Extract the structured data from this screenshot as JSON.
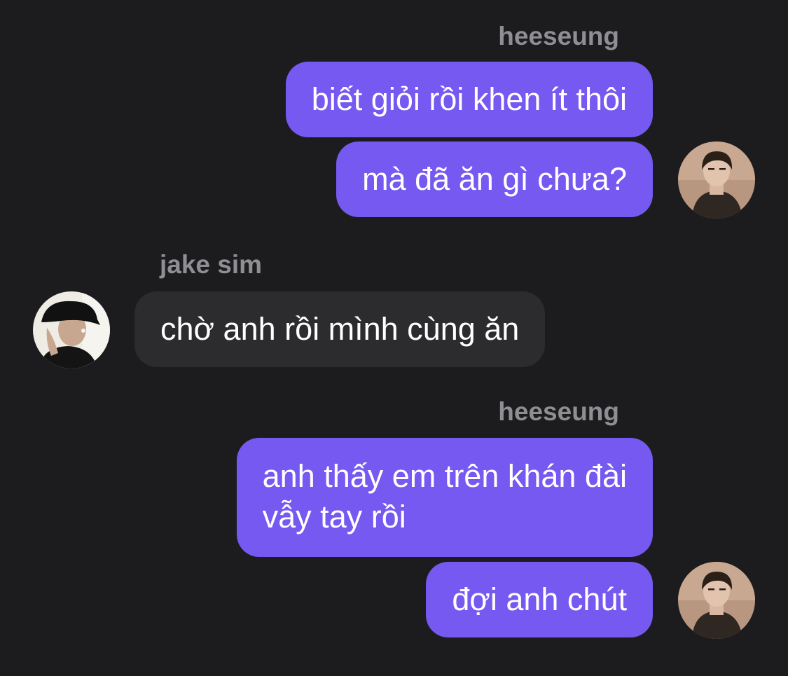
{
  "colors": {
    "background": "#1c1c1e",
    "sender_name": "#8e8e93",
    "outgoing_bubble": "#7559f0",
    "incoming_bubble": "#2c2c2e",
    "message_text": "#ffffff"
  },
  "thread": [
    {
      "sender": "heeseung",
      "side": "right",
      "avatar": "heeseung-avatar",
      "messages": [
        "biết giỏi rồi khen ít thôi",
        "mà đã ăn gì chưa?"
      ]
    },
    {
      "sender": "jake sim",
      "side": "left",
      "avatar": "jake-sim-avatar",
      "messages": [
        "chờ anh rồi mình cùng ăn"
      ]
    },
    {
      "sender": "heeseung",
      "side": "right",
      "avatar": "heeseung-avatar",
      "messages": [
        "anh thấy em trên khán đài\nvẫy tay rồi",
        "đợi anh chút"
      ]
    }
  ]
}
